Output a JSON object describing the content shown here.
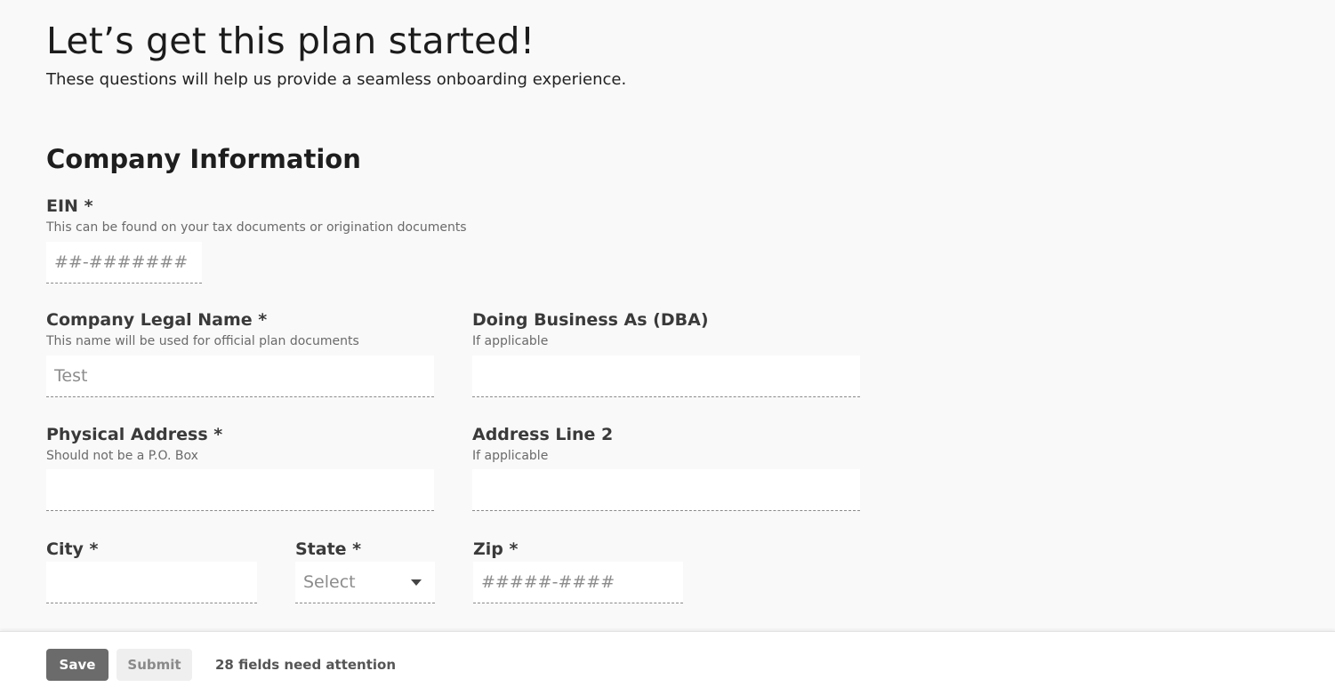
{
  "header": {
    "title": "Let’s get this plan started!",
    "subtitle": "These questions will help us provide a seamless onboarding experience."
  },
  "section": {
    "title": "Company Information"
  },
  "fields": {
    "ein": {
      "label": "EIN *",
      "hint": "This can be found on your tax documents or origination documents",
      "value": "",
      "placeholder": "##-#######"
    },
    "legal_name": {
      "label": "Company Legal Name *",
      "hint": "This name will be used for official plan documents",
      "value": "",
      "placeholder": "Test"
    },
    "dba": {
      "label": "Doing Business As (DBA)",
      "hint": "If applicable",
      "value": "",
      "placeholder": ""
    },
    "address": {
      "label": "Physical Address *",
      "hint": "Should not be a P.O. Box",
      "value": "",
      "placeholder": ""
    },
    "address2": {
      "label": "Address Line 2",
      "hint": "If applicable",
      "value": "",
      "placeholder": ""
    },
    "city": {
      "label": "City *",
      "value": "",
      "placeholder": ""
    },
    "state": {
      "label": "State *",
      "selected": "Select",
      "icon": "chevron-down-icon"
    },
    "zip": {
      "label": "Zip *",
      "value": "",
      "placeholder": "#####-####"
    }
  },
  "footer": {
    "save_label": "Save",
    "submit_label": "Submit",
    "attention_text": "28 fields need attention"
  },
  "colors": {
    "background": "#f9f9f9",
    "save_button": "#6b6b6b",
    "submit_button": "#efefef",
    "input_background": "#ffffff"
  }
}
